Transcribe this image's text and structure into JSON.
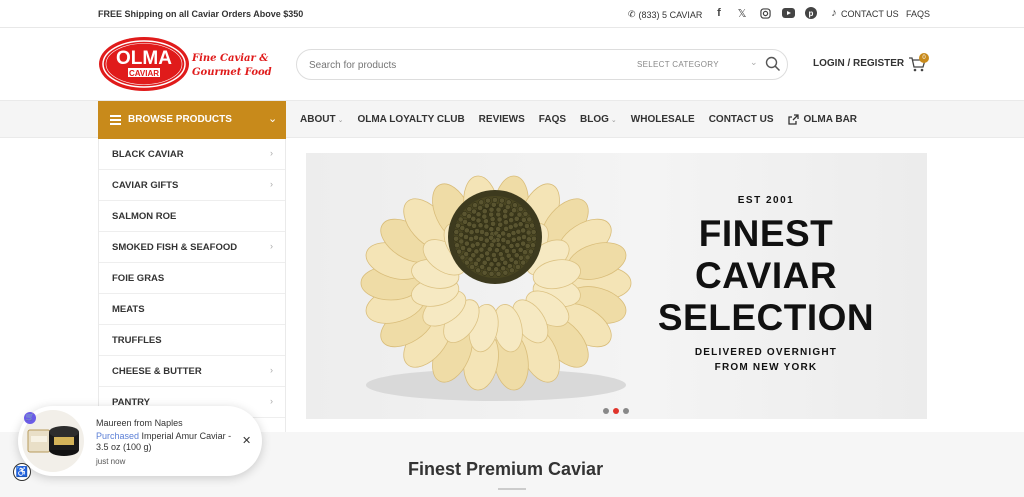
{
  "topbar": {
    "shipping_text": "FREE Shipping on all Caviar Orders Above $350",
    "phone": "(833) 5 CAVIAR",
    "contact_label": "CONTACT US",
    "faqs_label": "FAQS",
    "socials": [
      "facebook-icon",
      "x-icon",
      "instagram-icon",
      "youtube-icon",
      "pinterest-icon",
      "tiktok-icon"
    ]
  },
  "header": {
    "logo_top": "OLMA",
    "logo_bottom": "CAVIAR",
    "tagline_line1": "Fine Caviar &",
    "tagline_line2": "Gourmet Food",
    "search_placeholder": "Search for products",
    "category_label": "SELECT CATEGORY",
    "login_label": "LOGIN / REGISTER",
    "cart_count": "0"
  },
  "nav": {
    "browse_label": "BROWSE PRODUCTS",
    "links": [
      {
        "label": "ABOUT",
        "dropdown": true
      },
      {
        "label": "OLMA LOYALTY CLUB",
        "dropdown": false
      },
      {
        "label": "REVIEWS",
        "dropdown": false
      },
      {
        "label": "FAQS",
        "dropdown": false
      },
      {
        "label": "BLOG",
        "dropdown": true
      },
      {
        "label": "WHOLESALE",
        "dropdown": false
      },
      {
        "label": "CONTACT US",
        "dropdown": false
      },
      {
        "label": "OLMA BAR",
        "dropdown": false
      }
    ]
  },
  "sidebar": {
    "items": [
      {
        "label": "BLACK CAVIAR",
        "arrow": true
      },
      {
        "label": "CAVIAR GIFTS",
        "arrow": true
      },
      {
        "label": "SALMON ROE",
        "arrow": false
      },
      {
        "label": "SMOKED FISH & SEAFOOD",
        "arrow": true
      },
      {
        "label": "FOIE GRAS",
        "arrow": false
      },
      {
        "label": "MEATS",
        "arrow": false
      },
      {
        "label": "TRUFFLES",
        "arrow": false
      },
      {
        "label": "CHEESE & BUTTER",
        "arrow": true
      },
      {
        "label": "PANTRY",
        "arrow": true
      }
    ]
  },
  "hero": {
    "est": "EST 2001",
    "line1": "FINEST",
    "line2": "CAVIAR",
    "line3": "SELECTION",
    "sub1": "DELIVERED OVERNIGHT",
    "sub2": "FROM NEW YORK",
    "slides": 3,
    "active_slide": 2
  },
  "section": {
    "title": "Finest Premium Caviar"
  },
  "popup": {
    "customer": "Maureen",
    "from_word": "from",
    "city": "Naples",
    "purchased_word": "Purchased",
    "product": "Imperial Amur Caviar - 3.5 oz (100 g)",
    "time": "just now"
  },
  "colors": {
    "accent": "#c88a1b",
    "brand_red": "#e01b1b"
  }
}
